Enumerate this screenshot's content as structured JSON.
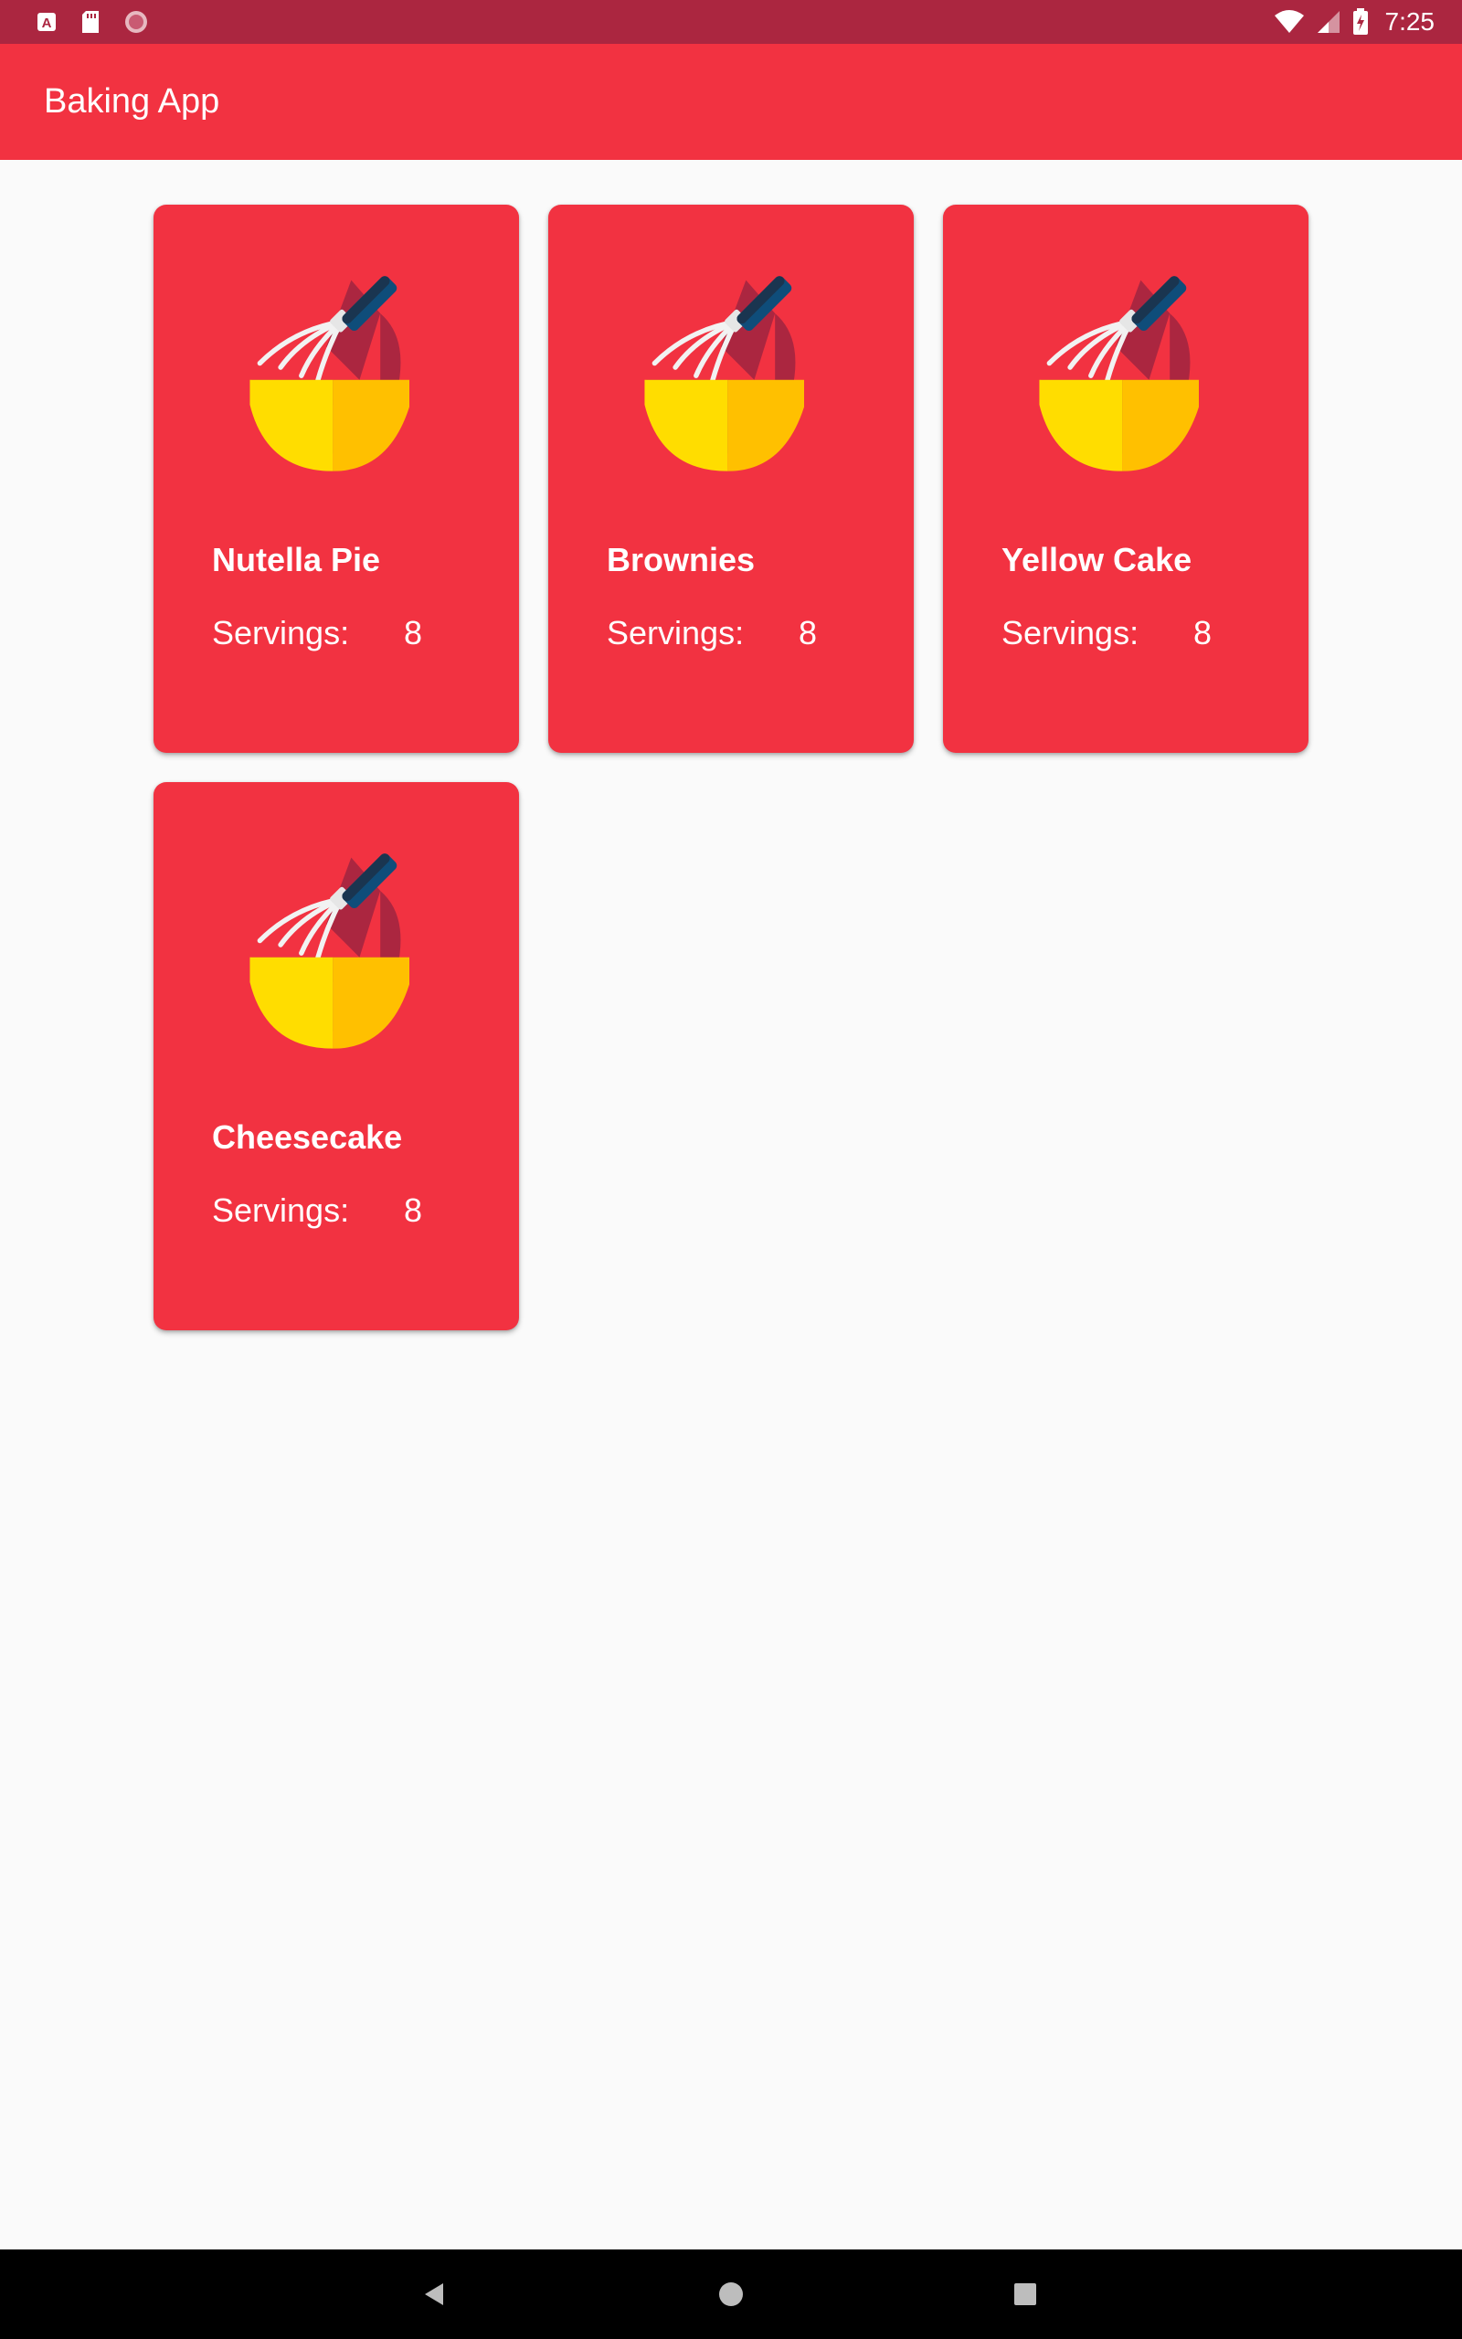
{
  "status_bar": {
    "time": "7:25",
    "left_icons": [
      "a-notification-icon",
      "sd-card-icon",
      "record-icon"
    ],
    "right_icons": [
      "wifi-icon",
      "cell-signal-icon",
      "battery-charging-icon"
    ]
  },
  "app_bar": {
    "title": "Baking App"
  },
  "recipes": [
    {
      "name": "Nutella Pie",
      "servings_label": "Servings:",
      "servings": "8"
    },
    {
      "name": "Brownies",
      "servings_label": "Servings:",
      "servings": "8"
    },
    {
      "name": "Yellow Cake",
      "servings_label": "Servings:",
      "servings": "8"
    },
    {
      "name": "Cheesecake",
      "servings_label": "Servings:",
      "servings": "8"
    }
  ],
  "nav_bar": {
    "icons": [
      "back-icon",
      "home-icon",
      "recents-icon"
    ]
  },
  "colors": {
    "status_bar": "#ab2640",
    "primary": "#f23241",
    "background": "#fafafa",
    "bowl_yellow": "#ffdd00",
    "bowl_orange": "#ffc000"
  }
}
